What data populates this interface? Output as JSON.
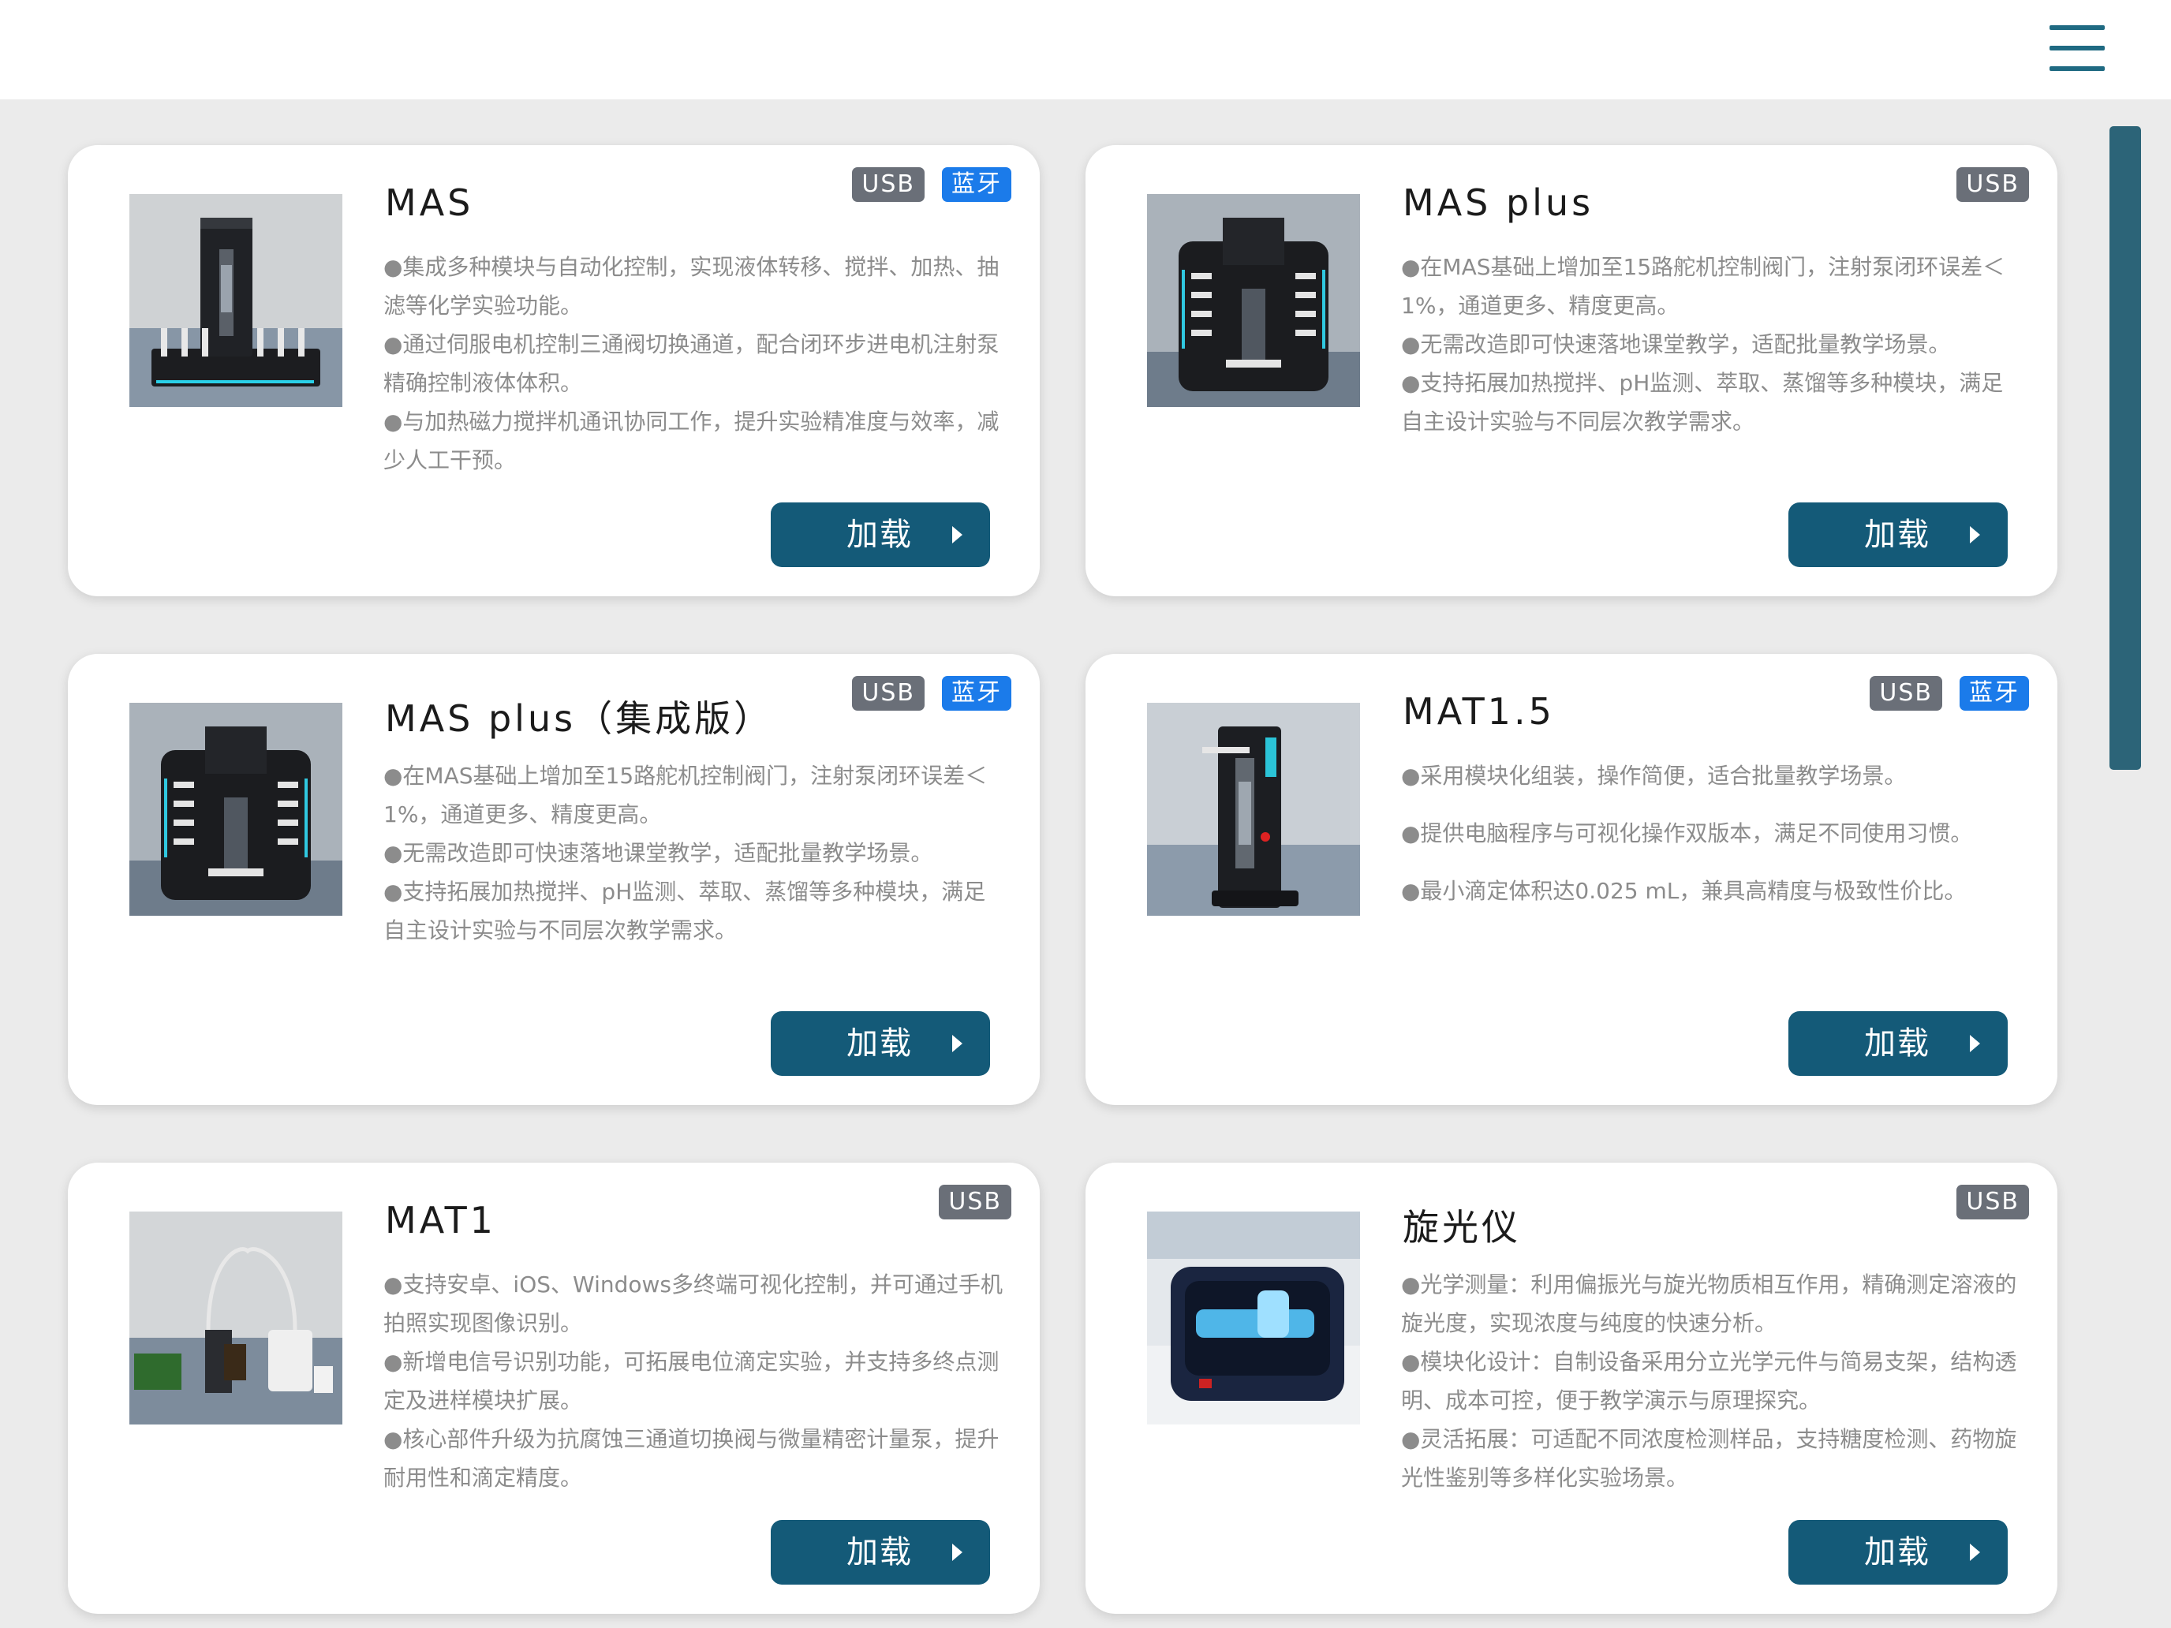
{
  "header": {
    "menu_icon": "hamburger-menu-icon"
  },
  "load_label": "加载",
  "cards": [
    {
      "title": "MAS",
      "badges": [
        "USB",
        "蓝牙"
      ],
      "lines": [
        "●集成多种模块与自动化控制，实现液体转移、搅拌、加热、抽滤等化学实验功能。",
        "●通过伺服电机控制三通阀切换通道，配合闭环步进电机注射泵精确控制液体体积。",
        "●与加热磁力搅拌机通讯协同工作，提升实验精准度与效率，减少人工干预。"
      ]
    },
    {
      "title": "MAS plus",
      "badges": [
        "USB"
      ],
      "lines": [
        "●在MAS基础上增加至15路舵机控制阀门，注射泵闭环误差＜1%，通道更多、精度更高。",
        "●无需改造即可快速落地课堂教学，适配批量教学场景。",
        "●支持拓展加热搅拌、pH监测、萃取、蒸馏等多种模块，满足自主设计实验与不同层次教学需求。"
      ]
    },
    {
      "title": "MAS plus（集成版）",
      "badges": [
        "USB",
        "蓝牙"
      ],
      "lines": [
        "●在MAS基础上增加至15路舵机控制阀门，注射泵闭环误差＜1%，通道更多、精度更高。",
        "●无需改造即可快速落地课堂教学，适配批量教学场景。",
        "●支持拓展加热搅拌、pH监测、萃取、蒸馏等多种模块，满足自主设计实验与不同层次教学需求。"
      ]
    },
    {
      "title": "MAT1.5",
      "badges": [
        "USB",
        "蓝牙"
      ],
      "lines": [
        "●采用模块化组装，操作简便，适合批量教学场景。",
        "●提供电脑程序与可视化操作双版本，满足不同使用习惯。",
        "●最小滴定体积达0.025 mL，兼具高精度与极致性价比。"
      ]
    },
    {
      "title": "MAT1",
      "badges": [
        "USB"
      ],
      "lines": [
        "●支持安卓、iOS、Windows多终端可视化控制，并可通过手机拍照实现图像识别。",
        "●新增电信号识别功能，可拓展电位滴定实验，并支持多终点测定及进样模块扩展。",
        "●核心部件升级为抗腐蚀三通道切换阀与微量精密计量泵，提升耐用性和滴定精度。"
      ]
    },
    {
      "title": "旋光仪",
      "badges": [
        "USB"
      ],
      "lines": [
        "●光学测量：利用偏振光与旋光物质相互作用，精确测定溶液的旋光度，实现浓度与纯度的快速分析。",
        "●模块化设计：自制设备采用分立光学元件与简易支架，结构透明、成本可控，便于教学演示与原理探究。",
        "●灵活拓展：可适配不同浓度检测样品，支持糖度检测、药物旋光性鉴别等多样化实验场景。"
      ]
    }
  ]
}
